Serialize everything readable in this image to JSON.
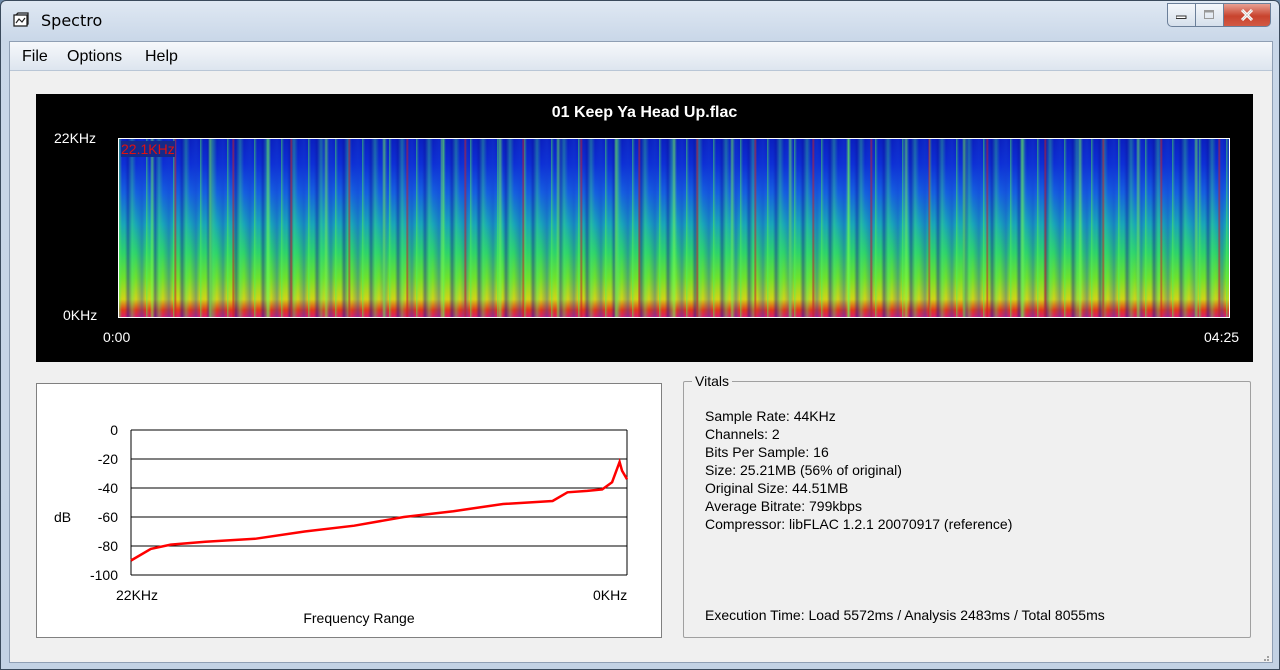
{
  "window": {
    "title": "Spectro"
  },
  "menu": [
    "File",
    "Options",
    "Help"
  ],
  "spectrogram": {
    "file_name": "01 Keep Ya Head Up.flac",
    "y_top_label": "22KHz",
    "y_bottom_label": "0KHz",
    "x_start_label": "0:00",
    "x_end_label": "04:25",
    "max_freq_label": "22.1KHz"
  },
  "vitals": {
    "legend": "Vitals",
    "lines": [
      "Sample Rate: 44KHz",
      "Channels: 2",
      "Bits Per Sample: 16",
      "Size: 25.21MB (56% of original)",
      "Original Size: 44.51MB",
      "Average Bitrate: 799kbps",
      "Compressor: libFLAC 1.2.1 20070917 (reference)"
    ],
    "execution_time": "Execution Time: Load 5572ms / Analysis 2483ms / Total 8055ms"
  },
  "chart_data": {
    "type": "line",
    "ylabel": "dB",
    "xlabel": "Frequency Range",
    "x_tick_labels": [
      "22KHz",
      "0KHz"
    ],
    "y_ticks": [
      0,
      -20,
      -40,
      -60,
      -80,
      -100
    ],
    "ylim": [
      -100,
      0
    ],
    "grid": true,
    "line_color": "#ff0000",
    "series": [
      {
        "x": [
          0,
          0.04,
          0.08,
          0.15,
          0.25,
          0.35,
          0.45,
          0.55,
          0.65,
          0.75,
          0.85,
          0.88,
          0.92,
          0.95,
          0.97,
          0.985,
          0.99,
          1.0
        ],
        "values": [
          -90,
          -82,
          -79,
          -77,
          -75,
          -70,
          -66,
          -60,
          -56,
          -51,
          -49,
          -43,
          -42,
          -41,
          -36,
          -22,
          -28,
          -34
        ]
      }
    ]
  }
}
